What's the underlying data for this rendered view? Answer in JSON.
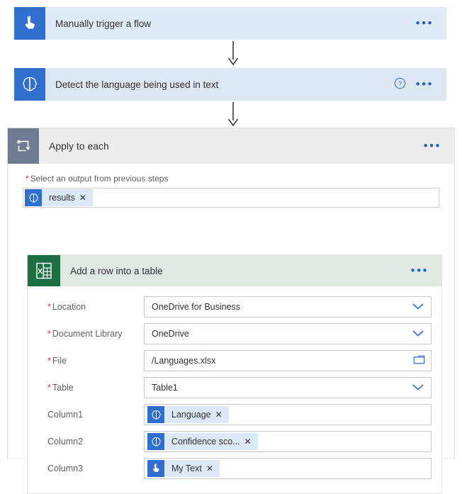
{
  "flow": {
    "steps": [
      {
        "id": "trigger",
        "title": "Manually trigger a flow",
        "icon": "tap-hand-icon",
        "has_help": false,
        "overflow_label": "•••"
      },
      {
        "id": "detect",
        "title": "Detect the language being used in text",
        "icon": "brain-cognitive-icon",
        "has_help": true,
        "help_label": "?",
        "overflow_label": "•••"
      }
    ],
    "loop": {
      "title": "Apply to each",
      "icon": "loop-repeat-icon",
      "overflow_label": "•••",
      "output_label": "Select an output from previous steps",
      "required_marker": "*",
      "output_token": {
        "label": "results",
        "icon": "brain-cognitive-icon",
        "remove_label": "✕"
      }
    },
    "excel": {
      "title": "Add a row into a table",
      "icon": "excel-icon",
      "overflow_label": "•••",
      "fields": [
        {
          "label": "Location",
          "required": true,
          "value": "OneDrive for Business",
          "control": "dropdown"
        },
        {
          "label": "Document Library",
          "required": true,
          "value": "OneDrive",
          "control": "dropdown"
        },
        {
          "label": "File",
          "required": true,
          "value": "/Languages.xlsx",
          "control": "filepicker"
        },
        {
          "label": "Table",
          "required": true,
          "value": "Table1",
          "control": "dropdown"
        }
      ],
      "columns": [
        {
          "label": "Column1",
          "required": false,
          "token": {
            "label": "Language",
            "icon": "brain-cognitive-icon",
            "remove_label": "✕"
          }
        },
        {
          "label": "Column2",
          "required": false,
          "token": {
            "label": "Confidence sco...",
            "icon": "brain-cognitive-icon",
            "remove_label": "✕"
          }
        },
        {
          "label": "Column3",
          "required": false,
          "token": {
            "label": "My Text",
            "icon": "tap-hand-icon",
            "remove_label": "✕"
          }
        }
      ]
    }
  },
  "colors": {
    "trigger_card_bg": "#deebf7",
    "action_card_bg": "#dce7f2",
    "connector_blue": "#2f6fd0",
    "loop_icon_bg": "#6e7b91",
    "excel_green": "#1d7044",
    "excel_header_bg": "#dfe9e2",
    "token_bg": "#dbe9f7",
    "required_red": "#d13438",
    "link_blue": "#2266cc"
  }
}
